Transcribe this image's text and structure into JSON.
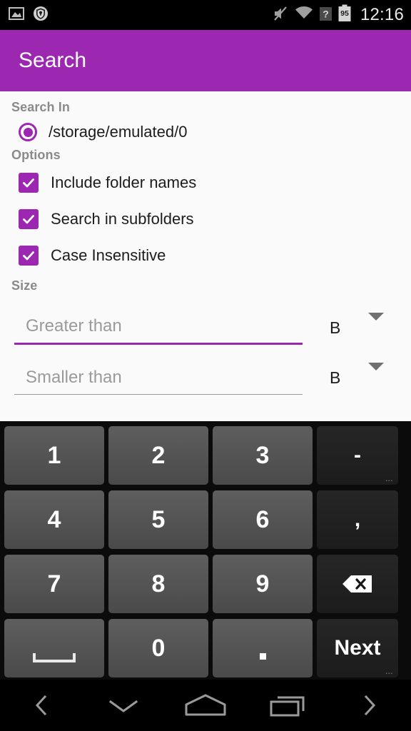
{
  "status_bar": {
    "icons": [
      "image-icon",
      "shield-lock-icon"
    ],
    "right_icons": [
      "mute-icon",
      "wifi-icon",
      "unknown-sim-icon",
      "battery-icon"
    ],
    "battery_level": "95",
    "time": "12:16"
  },
  "app_bar": {
    "title": "Search"
  },
  "content": {
    "search_in": {
      "label": "Search In",
      "option": {
        "label": "/storage/emulated/0",
        "selected": true
      }
    },
    "options": {
      "label": "Options",
      "items": [
        {
          "label": "Include folder names",
          "checked": true
        },
        {
          "label": "Search in subfolders",
          "checked": true
        },
        {
          "label": "Case Insensitive",
          "checked": true
        }
      ]
    },
    "size": {
      "label": "Size",
      "greater_than": {
        "placeholder": "Greater than",
        "value": "",
        "unit": "B",
        "focused": true
      },
      "smaller_than": {
        "placeholder": "Smaller than",
        "value": "",
        "unit": "B",
        "focused": false
      }
    }
  },
  "keyboard": {
    "rows": [
      [
        {
          "label": "1",
          "name": "key-1",
          "type": "num"
        },
        {
          "label": "2",
          "name": "key-2",
          "type": "num"
        },
        {
          "label": "3",
          "name": "key-3",
          "type": "num"
        },
        {
          "label": "-",
          "name": "key-minus",
          "type": "fn",
          "hint": "..."
        }
      ],
      [
        {
          "label": "4",
          "name": "key-4",
          "type": "num"
        },
        {
          "label": "5",
          "name": "key-5",
          "type": "num"
        },
        {
          "label": "6",
          "name": "key-6",
          "type": "num"
        },
        {
          "label": ",",
          "name": "key-comma",
          "type": "fn"
        }
      ],
      [
        {
          "label": "7",
          "name": "key-7",
          "type": "num"
        },
        {
          "label": "8",
          "name": "key-8",
          "type": "num"
        },
        {
          "label": "9",
          "name": "key-9",
          "type": "num"
        },
        {
          "label": "",
          "name": "key-backspace",
          "type": "fn",
          "icon": "backspace-icon"
        }
      ],
      [
        {
          "label": "",
          "name": "key-space",
          "type": "num",
          "icon": "space-icon"
        },
        {
          "label": "0",
          "name": "key-0",
          "type": "num"
        },
        {
          "label": "",
          "name": "key-period",
          "type": "num",
          "icon": "dot-icon"
        },
        {
          "label": "Next",
          "name": "key-next",
          "type": "fn",
          "hint": "..."
        }
      ]
    ]
  },
  "nav_bar": {
    "buttons": [
      {
        "name": "nav-back-chevron-left",
        "icon": "chevron-left-icon"
      },
      {
        "name": "nav-hide-keyboard",
        "icon": "chevron-down-icon"
      },
      {
        "name": "nav-home",
        "icon": "home-icon"
      },
      {
        "name": "nav-recents",
        "icon": "recents-icon"
      },
      {
        "name": "nav-forward-chevron-right",
        "icon": "chevron-right-icon"
      }
    ]
  },
  "colors": {
    "accent": "#9c27b0",
    "status_bar_bg": "#000000",
    "content_bg": "#fafafa"
  }
}
